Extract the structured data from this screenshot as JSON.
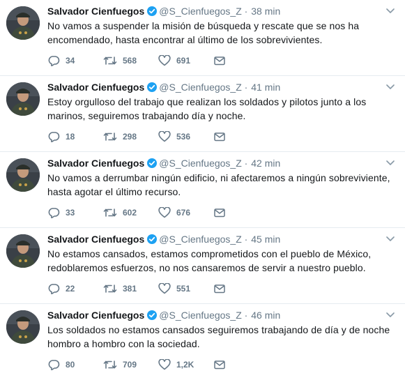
{
  "tweets": [
    {
      "name": "Salvador Cienfuegos",
      "handle": "@S_Cienfuegos_Z",
      "separator": "·",
      "time": "38 min",
      "text": "No vamos a suspender la misión de búsqueda y rescate que se nos ha encomendado, hasta encontrar al último de los sobrevivientes.",
      "replies": "34",
      "retweets": "568",
      "likes": "691"
    },
    {
      "name": "Salvador Cienfuegos",
      "handle": "@S_Cienfuegos_Z",
      "separator": "·",
      "time": "41 min",
      "text": "Estoy orgulloso del trabajo que realizan los soldados y pilotos junto a los marinos, seguiremos trabajando día y noche.",
      "replies": "18",
      "retweets": "298",
      "likes": "536"
    },
    {
      "name": "Salvador Cienfuegos",
      "handle": "@S_Cienfuegos_Z",
      "separator": "·",
      "time": "42 min",
      "text": "No vamos a derrumbar ningún edificio, ni afectaremos a ningún sobreviviente, hasta agotar el último recurso.",
      "replies": "33",
      "retweets": "602",
      "likes": "676"
    },
    {
      "name": "Salvador Cienfuegos",
      "handle": "@S_Cienfuegos_Z",
      "separator": "·",
      "time": "45 min",
      "text": "No estamos cansados, estamos comprometidos con el pueblo de México, redoblaremos esfuerzos, no nos cansaremos de servir a nuestro pueblo.",
      "replies": "22",
      "retweets": "381",
      "likes": "551"
    },
    {
      "name": "Salvador Cienfuegos",
      "handle": "@S_Cienfuegos_Z",
      "separator": "·",
      "time": "46 min",
      "text": "Los soldados no estamos cansados seguiremos trabajando de día y de noche hombro a hombro con la sociedad.",
      "replies": "80",
      "retweets": "709",
      "likes": "1,2K"
    }
  ],
  "icons": {
    "reply": "reply-icon",
    "retweet": "retweet-icon",
    "like": "heart-icon",
    "message": "envelope-icon",
    "verified": "verified-badge-icon",
    "caret": "chevron-down-icon"
  },
  "colors": {
    "text": "#14171a",
    "muted": "#657786",
    "verified": "#1da1f2",
    "divider": "#e6ecf0"
  }
}
